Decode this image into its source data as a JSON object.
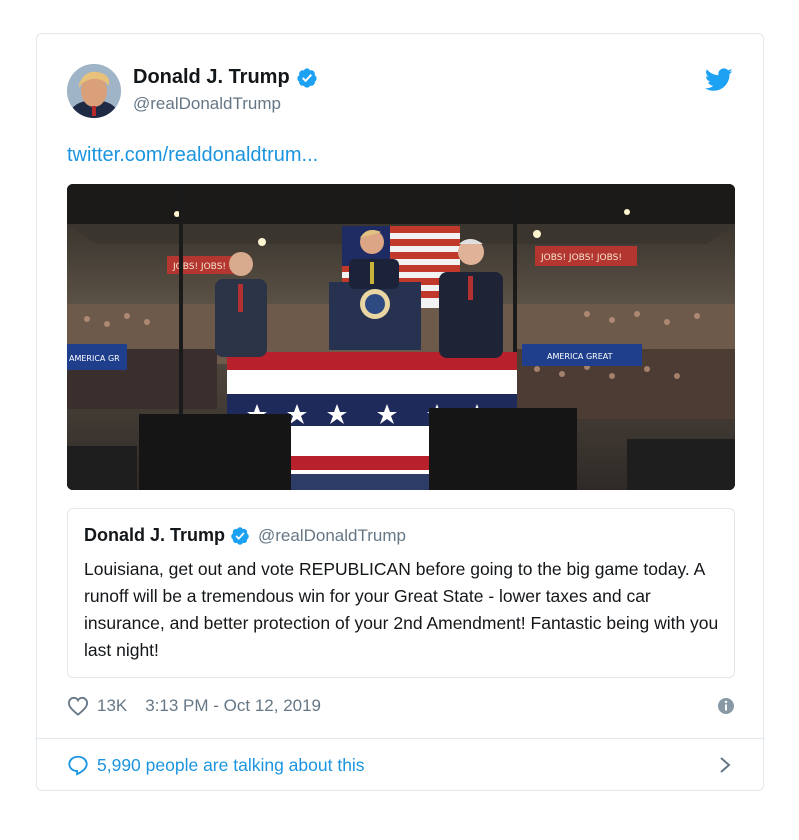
{
  "tweet": {
    "author": {
      "display_name": "Donald J. Trump",
      "handle": "@realDonaldTrump",
      "avatar_icon": "avatar-portrait",
      "verified_icon": "verified-badge-icon"
    },
    "link_text": "twitter.com/realdonaldtrum...",
    "media": {
      "banner_left": "JOBS! JOBS!",
      "banner_right": "JOBS! JOBS! JOBS!",
      "banner_lower_left": "AMERICA GR",
      "banner_lower_right": "AMERICA GREAT"
    },
    "quoted": {
      "display_name": "Donald J. Trump",
      "handle": "@realDonaldTrump",
      "text": "Louisiana, get out and vote REPUBLICAN before going to the big game today. A runoff will be a tremendous win for your Great State - lower taxes and car insurance, and better protection of your 2nd Amendment! Fantastic being with you last night!"
    },
    "likes": "13K",
    "timestamp": "3:13 PM - Oct 12, 2019",
    "talking": "5,990 people are talking about this"
  },
  "colors": {
    "link": "#1b95e0",
    "muted": "#657786",
    "border": "#e1e8ed"
  }
}
